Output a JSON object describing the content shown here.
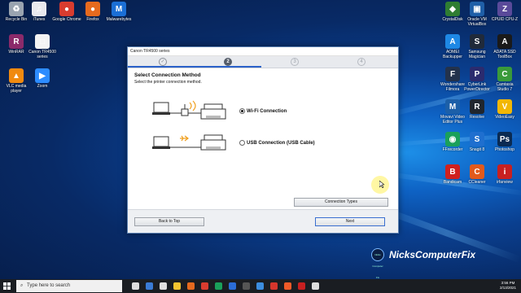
{
  "desktop": {
    "left_icons": [
      {
        "label": "Recycle Bin",
        "color": "#9aa4b0",
        "glyph": "♻"
      },
      {
        "label": "iTunes",
        "color": "#e8e8ee",
        "glyph": "♫"
      },
      {
        "label": "Google Chrome",
        "color": "#d93c2f",
        "glyph": "●"
      },
      {
        "label": "Firefox",
        "color": "#e66a1e",
        "glyph": "●"
      },
      {
        "label": "Malwarebytes",
        "color": "#1b6fd6",
        "glyph": "M"
      },
      {
        "label": "WinRAR",
        "color": "#8b2a6a",
        "glyph": "R"
      },
      {
        "label": "Canon TR4500 series",
        "color": "#f4f4f4",
        "glyph": "□"
      },
      {
        "label": "VLC media player",
        "color": "#f08a10",
        "glyph": "▲"
      },
      {
        "label": "Zoom",
        "color": "#2d8cff",
        "glyph": "▶"
      }
    ],
    "right_icons": [
      {
        "label": "CrystalDisk",
        "color": "#2f7d32",
        "glyph": "◆"
      },
      {
        "label": "Oracle VM VirtualBox",
        "color": "#1f5fa8",
        "glyph": "▣"
      },
      {
        "label": "CPUID CPU-Z",
        "color": "#5a4a9a",
        "glyph": "Z"
      },
      {
        "label": "AOMEI Backupper",
        "color": "#1e88e5",
        "glyph": "A"
      },
      {
        "label": "Samsung Magician",
        "color": "#202a3a",
        "glyph": "S"
      },
      {
        "label": "ADATA SSD ToolBox",
        "color": "#1a1a1a",
        "glyph": "A"
      },
      {
        "label": "Wondershare Filmora",
        "color": "#23324c",
        "glyph": "F"
      },
      {
        "label": "CyberLink PowerDirector",
        "color": "#2b2b6e",
        "glyph": "P"
      },
      {
        "label": "Camtasia Studio 7",
        "color": "#3a9a3a",
        "glyph": "C"
      },
      {
        "label": "Movavi Video Editor Plus",
        "color": "#1c5fa8",
        "glyph": "M"
      },
      {
        "label": "Resolve",
        "color": "#20262e",
        "glyph": "R"
      },
      {
        "label": "VideoEasy",
        "color": "#f2b705",
        "glyph": "V"
      },
      {
        "label": "FFrecorder",
        "color": "#1aa05a",
        "glyph": "◉"
      },
      {
        "label": "Snagit 8",
        "color": "#1f6fcf",
        "glyph": "S"
      },
      {
        "label": "Photoshop",
        "color": "#0a2a52",
        "glyph": "Ps"
      },
      {
        "label": "Bandicam",
        "color": "#d0201e",
        "glyph": "B"
      },
      {
        "label": "CCleaner",
        "color": "#e25a1c",
        "glyph": "C"
      },
      {
        "label": "irfanview",
        "color": "#c82020",
        "glyph": "i"
      }
    ]
  },
  "window": {
    "title": "Canon TR4500 series",
    "steps": [
      "✓",
      "2",
      "3",
      "4"
    ],
    "heading": "Select Connection Method",
    "subheading": "Select the printer connection method.",
    "options": [
      {
        "label": "Wi-Fi Connection",
        "selected": true
      },
      {
        "label": "USB Connection (USB Cable)",
        "selected": false
      }
    ],
    "connection_types_label": "Connection Types",
    "back_label": "Back to Top",
    "next_label": "Next"
  },
  "brand": {
    "logo_text": "Nicks Computer Fix",
    "name": "NicksComputerFix"
  },
  "taskbar": {
    "search_placeholder": "Type here to search",
    "time": "3:56 PM",
    "date": "2/13/2021"
  }
}
